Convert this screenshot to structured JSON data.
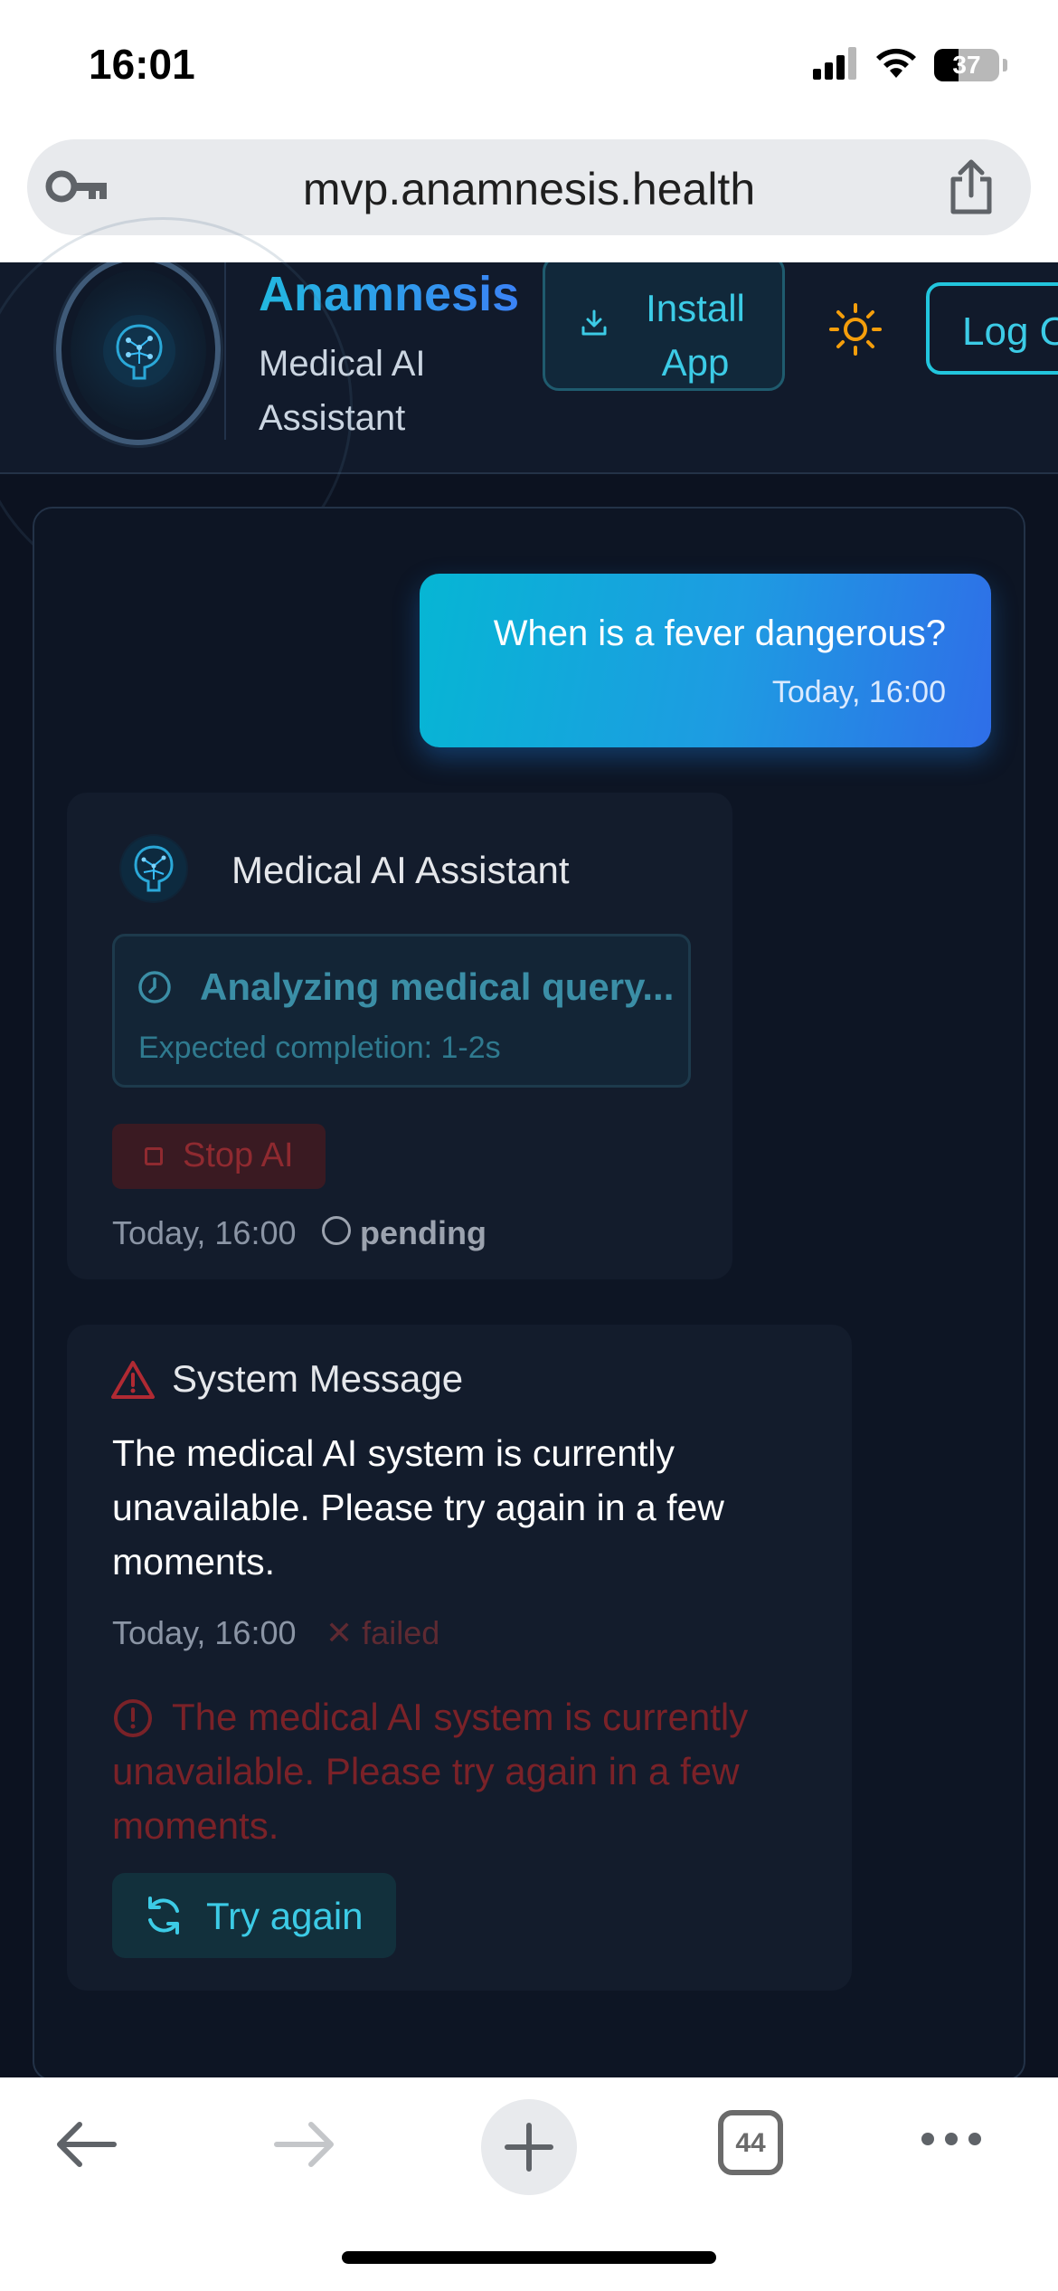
{
  "status_bar": {
    "time": "16:01",
    "battery_level": "37",
    "battery_fraction": 0.37,
    "icons": [
      "signal-icon",
      "wifi-icon",
      "battery-icon"
    ]
  },
  "browser": {
    "url": "mvp.anamnesis.health",
    "tab_count": "44",
    "icons": [
      "key-icon",
      "share-icon",
      "back-arrow-icon",
      "forward-arrow-icon",
      "plus-icon",
      "tabs-icon",
      "more-icon"
    ]
  },
  "header": {
    "brand_name": "Anamnesis",
    "subtitle": "Medical AI Assistant",
    "install_label": "Install App",
    "login_label": "Log Out",
    "theme_icon": "sun-icon",
    "colors": {
      "accent": "#22c5dd",
      "brand_start": "#22b8e0",
      "brand_end": "#3b82f6",
      "theme_icon": "#f59e0b"
    }
  },
  "chat": {
    "user_message": {
      "text": "When is a fever dangerous?",
      "time": "Today, 16:00"
    },
    "ai_message": {
      "sender": "Medical AI Assistant",
      "status_title": "Analyzing medical query...",
      "status_detail": "Expected completion: 1-2s",
      "stop_label": "Stop AI",
      "time": "Today, 16:00",
      "state": "pending"
    },
    "system_message": {
      "title": "System Message",
      "body": "The medical AI system is currently unavailable. Please try again in a few moments.",
      "time": "Today, 16:00",
      "state": "failed",
      "error_text": "The medical AI system is currently unavailable. Please try again in a few moments.",
      "retry_label": "Try again",
      "colors": {
        "error": "#7a2228",
        "warning_icon": "#b02a33"
      }
    }
  }
}
